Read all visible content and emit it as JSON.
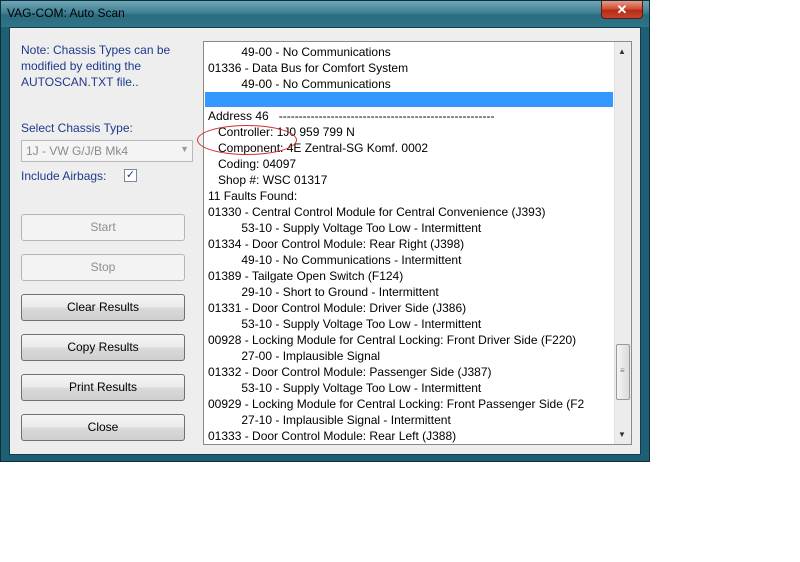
{
  "window": {
    "title": "VAG-COM: Auto Scan",
    "close_glyph": "✕"
  },
  "left_panel": {
    "note": "Note:  Chassis Types can be modified by editing the AUTOSCAN.TXT file..",
    "chassis_label": "Select Chassis Type:",
    "chassis_value": "1J - VW G/J/B Mk4",
    "airbags_label": "Include Airbags:",
    "airbags_checked": true,
    "buttons": {
      "start": "Start",
      "stop": "Stop",
      "clear": "Clear Results",
      "copy": "Copy Results",
      "print": "Print Results",
      "close": "Close"
    }
  },
  "results": [
    "          49-00 - No Communications",
    "01336 - Data Bus for Comfort System",
    "          49-00 - No Communications",
    "",
    "Address 46   ------------------------------------------------------",
    "   Controller: 1J0 959 799 N",
    "   Component: 4E Zentral-SG Komf. 0002",
    "   Coding: 04097",
    "   Shop #: WSC 01317",
    "11 Faults Found:",
    "01330 - Central Control Module for Central Convenience (J393)",
    "          53-10 - Supply Voltage Too Low - Intermittent",
    "01334 - Door Control Module: Rear Right (J398)",
    "          49-10 - No Communications - Intermittent",
    "01389 - Tailgate Open Switch (F124)",
    "          29-10 - Short to Ground - Intermittent",
    "01331 - Door Control Module: Driver Side (J386)",
    "          53-10 - Supply Voltage Too Low - Intermittent",
    "00928 - Locking Module for Central Locking: Front Driver Side (F220)",
    "          27-00 - Implausible Signal",
    "01332 - Door Control Module: Passenger Side (J387)",
    "          53-10 - Supply Voltage Too Low - Intermittent",
    "00929 - Locking Module for Central Locking: Front Passenger Side (F2",
    "          27-10 - Implausible Signal - Intermittent",
    "01333 - Door Control Module: Rear Left (J388)"
  ],
  "icons": {
    "check": "✓",
    "dropdown": "▼",
    "scroll_up": "▲",
    "scroll_down": "▼",
    "grip": "≡"
  },
  "colors": {
    "selection": "#3399ff",
    "label_blue": "#1f3a8a",
    "annotation_red": "#d03030",
    "frame": "#1f5f74"
  }
}
